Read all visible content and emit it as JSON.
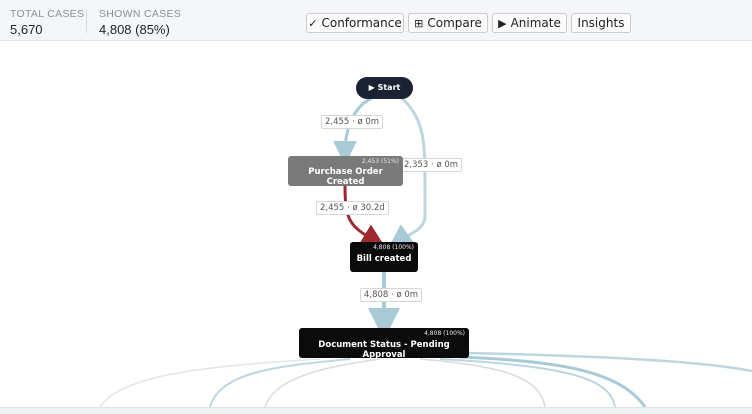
{
  "stats": {
    "total_label": "TOTAL CASES",
    "total_value": "5,670",
    "shown_label": "SHOWN CASES",
    "shown_value": "4,808 (85%)"
  },
  "toolbar": {
    "conformance": {
      "icon": "✓",
      "label": "Conformance"
    },
    "compare": {
      "icon": "⊞",
      "label": "Compare"
    },
    "animate": {
      "icon": "▶",
      "label": "Animate"
    },
    "insights": {
      "label": "Insights"
    }
  },
  "nodes": {
    "start": {
      "icon": "▶",
      "label": "Start"
    },
    "purchase_order": {
      "label": "Purchase Order Created",
      "count": "2,453 (51%)"
    },
    "bill_created": {
      "label": "Bill created",
      "count": "4,808 (100%)"
    },
    "doc_status": {
      "label": "Document Status - Pending Approval",
      "count": "4,808 (100%)"
    }
  },
  "edges": {
    "start_to_po": "2,455 · ø 0m",
    "start_to_bill": "2,353 · ø 0m",
    "po_to_bill": "2,455 · ø 30.2d",
    "bill_to_doc": "4,808 · ø 0m"
  },
  "colors": {
    "edge": "#a9cbd8",
    "edge_slow": "#9e2a2f",
    "node_dark": "#0b0b0b",
    "node_grey": "#7a7a7a",
    "start": "#1a2233"
  }
}
